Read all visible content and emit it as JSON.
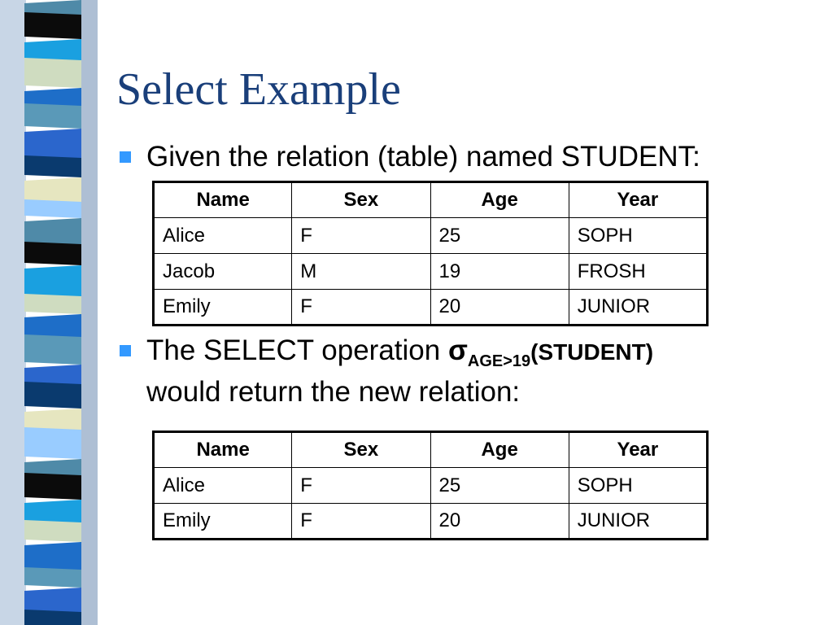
{
  "slide": {
    "title": "Select Example",
    "bullet1": "Given the relation (table) named STUDENT:",
    "bullet2": {
      "prefix": "The SELECT operation ",
      "sigma": "σ",
      "subscript": "AGE>19",
      "relation": "(STUDENT)",
      "line2": "would return the new relation:"
    }
  },
  "table1": {
    "headers": [
      "Name",
      "Sex",
      "Age",
      "Year"
    ],
    "rows": [
      [
        "Alice",
        "F",
        "25",
        "SOPH"
      ],
      [
        "Jacob",
        "M",
        "19",
        "FROSH"
      ],
      [
        "Emily",
        "F",
        "20",
        "JUNIOR"
      ]
    ]
  },
  "table2": {
    "headers": [
      "Name",
      "Sex",
      "Age",
      "Year"
    ],
    "rows": [
      [
        "Alice",
        "F",
        "25",
        "SOPH"
      ],
      [
        "Emily",
        "F",
        "20",
        "JUNIOR"
      ]
    ]
  },
  "colors": {
    "title": "#1a3f7a",
    "bullet": "#3399ff",
    "stripe": [
      "#4f8aa8",
      "#0a3a6e",
      "#1e6ec8",
      "#0b0b0b",
      "#e6e6c0",
      "#5a99b8",
      "#1aa0e0",
      "#99ccff",
      "#2b66cc",
      "#cfdcc0"
    ]
  }
}
